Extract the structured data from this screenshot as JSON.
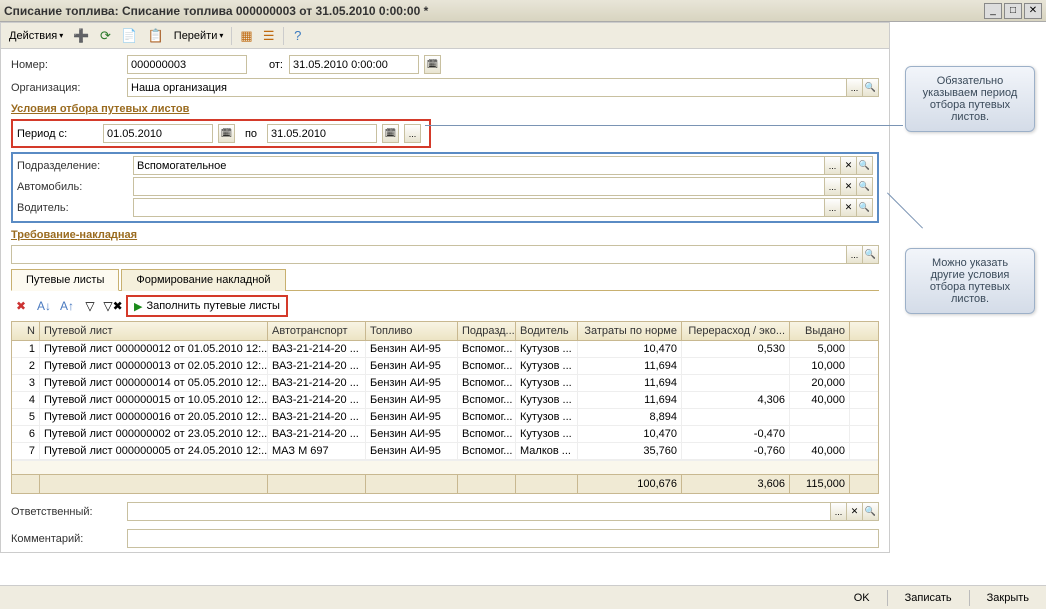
{
  "title": "Списание топлива: Списание топлива 000000003 от 31.05.2010 0:00:00 *",
  "toolbar": {
    "actions": "Действия"
  },
  "actions_menu": "Перейти",
  "fields": {
    "number_lbl": "Номер:",
    "number_val": "000000003",
    "ot_lbl": "от:",
    "ot_val": "31.05.2010 0:00:00",
    "org_lbl": "Организация:",
    "org_val": "Наша организация",
    "section1": "Условия отбора путевых листов",
    "period_from_lbl": "Период с:",
    "period_from_val": "01.05.2010",
    "period_to_lbl": "по",
    "period_to_val": "31.05.2010",
    "subdiv_lbl": "Подразделение:",
    "subdiv_val": "Вспомогательное",
    "auto_lbl": "Автомобиль:",
    "auto_val": "",
    "driver_lbl": "Водитель:",
    "driver_val": "",
    "section2": "Требование-накладная"
  },
  "tabs": {
    "t1": "Путевые листы",
    "t2": "Формирование накладной"
  },
  "fill_btn": "Заполнить путевые листы",
  "grid": {
    "head": {
      "n": "N",
      "pl": "Путевой лист",
      "auto": "Автотранспорт",
      "fuel": "Топливо",
      "pod": "Подразд...",
      "drv": "Водитель",
      "nrm": "Затраты по норме",
      "over": "Перерасход / эко...",
      "out": "Выдано"
    },
    "rows": [
      {
        "n": "1",
        "pl": "Путевой лист 000000012 от 01.05.2010 12:...",
        "auto": "ВАЗ-21-214-20 ...",
        "fuel": "Бензин АИ-95",
        "pod": "Вспомог...",
        "drv": "Кутузов ...",
        "nrm": "10,470",
        "over": "0,530",
        "out": "5,000"
      },
      {
        "n": "2",
        "pl": "Путевой лист 000000013 от 02.05.2010 12:...",
        "auto": "ВАЗ-21-214-20 ...",
        "fuel": "Бензин АИ-95",
        "pod": "Вспомог...",
        "drv": "Кутузов ...",
        "nrm": "11,694",
        "over": "",
        "out": "10,000"
      },
      {
        "n": "3",
        "pl": "Путевой лист 000000014 от 05.05.2010 12:...",
        "auto": "ВАЗ-21-214-20 ...",
        "fuel": "Бензин АИ-95",
        "pod": "Вспомог...",
        "drv": "Кутузов ...",
        "nrm": "11,694",
        "over": "",
        "out": "20,000"
      },
      {
        "n": "4",
        "pl": "Путевой лист 000000015 от 10.05.2010 12:...",
        "auto": "ВАЗ-21-214-20 ...",
        "fuel": "Бензин АИ-95",
        "pod": "Вспомог...",
        "drv": "Кутузов ...",
        "nrm": "11,694",
        "over": "4,306",
        "out": "40,000"
      },
      {
        "n": "5",
        "pl": "Путевой лист 000000016 от 20.05.2010 12:...",
        "auto": "ВАЗ-21-214-20 ...",
        "fuel": "Бензин АИ-95",
        "pod": "Вспомог...",
        "drv": "Кутузов ...",
        "nrm": "8,894",
        "over": "",
        "out": ""
      },
      {
        "n": "6",
        "pl": "Путевой лист 000000002 от 23.05.2010 12:...",
        "auto": "ВАЗ-21-214-20 ...",
        "fuel": "Бензин АИ-95",
        "pod": "Вспомог...",
        "drv": "Кутузов ...",
        "nrm": "10,470",
        "over": "-0,470",
        "out": ""
      },
      {
        "n": "7",
        "pl": "Путевой лист 000000005 от 24.05.2010 12:...",
        "auto": "МАЗ М 697",
        "fuel": "Бензин АИ-95",
        "pod": "Вспомог...",
        "drv": "Малков ...",
        "nrm": "35,760",
        "over": "-0,760",
        "out": "40,000"
      }
    ],
    "foot": {
      "nrm": "100,676",
      "over": "3,606",
      "out": "115,000"
    }
  },
  "bottom": {
    "resp_lbl": "Ответственный:",
    "resp_val": "",
    "comm_lbl": "Комментарий:",
    "comm_val": ""
  },
  "statusbar": {
    "ok": "OK",
    "save": "Записать",
    "close": "Закрыть"
  },
  "callouts": {
    "c1": "Обязательно указываем период отбора путевых листов.",
    "c2": "Можно указать другие условия отбора путевых листов."
  }
}
